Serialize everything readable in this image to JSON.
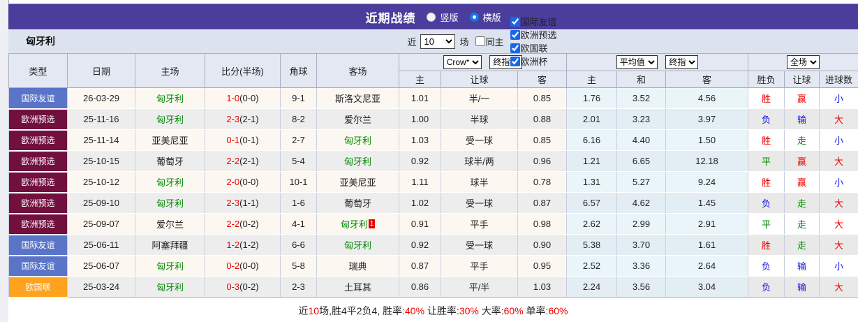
{
  "colors": {
    "accent_purple": "#4a3d9c",
    "type_国际友谊": "#5a74c8",
    "type_欧洲预选": "#71103f",
    "type_欧国联": "#ffa21d",
    "team_green": "#008800",
    "red": "#f00000",
    "blue": "#1414e0",
    "green": "#008800"
  },
  "titlebar": {
    "title": "近期战绩",
    "radio_vertical_label": "竖版",
    "radio_horizontal_label": "横版",
    "selected_layout": "横版"
  },
  "filter": {
    "team": "匈牙利",
    "near_label": "近",
    "match_count": "10",
    "games_label": "场",
    "same_home_label": "同主",
    "same_home_checked": false,
    "league_filters": [
      {
        "label": "国际友谊",
        "checked": true
      },
      {
        "label": "欧洲预选",
        "checked": true
      },
      {
        "label": "欧国联",
        "checked": true
      },
      {
        "label": "欧洲杯",
        "checked": true
      }
    ]
  },
  "table": {
    "main_headers": [
      "类型",
      "日期",
      "主场",
      "比分(半场)",
      "角球",
      "客场"
    ],
    "selects": {
      "company": "Crow*",
      "company_stage": "终指",
      "average": "平均值",
      "average_stage": "终指",
      "scope": "全场"
    },
    "sub_headers": [
      "主",
      "让球",
      "客",
      "主",
      "和",
      "客",
      "胜负",
      "让球",
      "进球数"
    ],
    "rows": [
      {
        "type": "国际友谊",
        "date": "26-03-29",
        "home": "匈牙利",
        "home_focus": true,
        "score": "1-0",
        "half": "(0-0)",
        "corners": "9-1",
        "away": "斯洛文尼亚",
        "away_focus": false,
        "away_sup": "",
        "odds": [
          "1.01",
          "半/一",
          "0.85"
        ],
        "avg": [
          "1.76",
          "3.52",
          "4.56"
        ],
        "outcome": [
          "胜",
          "red"
        ],
        "handicap": [
          "赢",
          "red"
        ],
        "goals": [
          "小",
          "blue"
        ]
      },
      {
        "type": "欧洲预选",
        "date": "25-11-16",
        "home": "匈牙利",
        "home_focus": true,
        "score": "2-3",
        "half": "(2-1)",
        "corners": "8-2",
        "away": "爱尔兰",
        "away_focus": false,
        "away_sup": "",
        "odds": [
          "1.00",
          "半球",
          "0.88"
        ],
        "avg": [
          "2.01",
          "3.23",
          "3.97"
        ],
        "outcome": [
          "负",
          "blue"
        ],
        "handicap": [
          "输",
          "blue"
        ],
        "goals": [
          "大",
          "red"
        ]
      },
      {
        "type": "欧洲预选",
        "date": "25-11-14",
        "home": "亚美尼亚",
        "home_focus": false,
        "score": "0-1",
        "half": "(0-1)",
        "corners": "2-7",
        "away": "匈牙利",
        "away_focus": true,
        "away_sup": "",
        "odds": [
          "1.03",
          "受一球",
          "0.85"
        ],
        "avg": [
          "6.16",
          "4.40",
          "1.50"
        ],
        "outcome": [
          "胜",
          "red"
        ],
        "handicap": [
          "走",
          "green"
        ],
        "goals": [
          "小",
          "blue"
        ]
      },
      {
        "type": "欧洲预选",
        "date": "25-10-15",
        "home": "葡萄牙",
        "home_focus": false,
        "score": "2-2",
        "half": "(2-1)",
        "corners": "5-4",
        "away": "匈牙利",
        "away_focus": true,
        "away_sup": "",
        "odds": [
          "0.92",
          "球半/两",
          "0.96"
        ],
        "avg": [
          "1.21",
          "6.65",
          "12.18"
        ],
        "outcome": [
          "平",
          "green"
        ],
        "handicap": [
          "赢",
          "red"
        ],
        "goals": [
          "大",
          "red"
        ]
      },
      {
        "type": "欧洲预选",
        "date": "25-10-12",
        "home": "匈牙利",
        "home_focus": true,
        "score": "2-0",
        "half": "(0-0)",
        "corners": "10-1",
        "away": "亚美尼亚",
        "away_focus": false,
        "away_sup": "",
        "odds": [
          "1.11",
          "球半",
          "0.78"
        ],
        "avg": [
          "1.31",
          "5.27",
          "9.24"
        ],
        "outcome": [
          "胜",
          "red"
        ],
        "handicap": [
          "赢",
          "red"
        ],
        "goals": [
          "小",
          "blue"
        ]
      },
      {
        "type": "欧洲预选",
        "date": "25-09-10",
        "home": "匈牙利",
        "home_focus": true,
        "score": "2-3",
        "half": "(1-1)",
        "corners": "1-6",
        "away": "葡萄牙",
        "away_focus": false,
        "away_sup": "",
        "odds": [
          "1.02",
          "受一球",
          "0.87"
        ],
        "avg": [
          "6.57",
          "4.62",
          "1.45"
        ],
        "outcome": [
          "负",
          "blue"
        ],
        "handicap": [
          "走",
          "green"
        ],
        "goals": [
          "大",
          "red"
        ]
      },
      {
        "type": "欧洲预选",
        "date": "25-09-07",
        "home": "爱尔兰",
        "home_focus": false,
        "score": "2-2",
        "half": "(0-2)",
        "corners": "4-1",
        "away": "匈牙利",
        "away_focus": true,
        "away_sup": "1",
        "odds": [
          "0.91",
          "平手",
          "0.98"
        ],
        "avg": [
          "2.62",
          "2.99",
          "2.91"
        ],
        "outcome": [
          "平",
          "green"
        ],
        "handicap": [
          "走",
          "green"
        ],
        "goals": [
          "大",
          "red"
        ]
      },
      {
        "type": "国际友谊",
        "date": "25-06-11",
        "home": "阿塞拜疆",
        "home_focus": false,
        "score": "1-2",
        "half": "(1-2)",
        "corners": "6-6",
        "away": "匈牙利",
        "away_focus": true,
        "away_sup": "",
        "odds": [
          "0.92",
          "受一球",
          "0.90"
        ],
        "avg": [
          "5.38",
          "3.70",
          "1.61"
        ],
        "outcome": [
          "胜",
          "red"
        ],
        "handicap": [
          "走",
          "green"
        ],
        "goals": [
          "大",
          "red"
        ]
      },
      {
        "type": "国际友谊",
        "date": "25-06-07",
        "home": "匈牙利",
        "home_focus": true,
        "score": "0-2",
        "half": "(0-0)",
        "corners": "5-8",
        "away": "瑞典",
        "away_focus": false,
        "away_sup": "",
        "odds": [
          "0.87",
          "平手",
          "0.95"
        ],
        "avg": [
          "2.52",
          "3.36",
          "2.64"
        ],
        "outcome": [
          "负",
          "blue"
        ],
        "handicap": [
          "输",
          "blue"
        ],
        "goals": [
          "小",
          "blue"
        ]
      },
      {
        "type": "欧国联",
        "date": "25-03-24",
        "home": "匈牙利",
        "home_focus": true,
        "score": "0-3",
        "half": "(0-2)",
        "corners": "2-3",
        "away": "土耳其",
        "away_focus": false,
        "away_sup": "",
        "odds": [
          "0.86",
          "平/半",
          "1.03"
        ],
        "avg": [
          "2.24",
          "3.56",
          "3.04"
        ],
        "outcome": [
          "负",
          "blue"
        ],
        "handicap": [
          "输",
          "blue"
        ],
        "goals": [
          "大",
          "red"
        ]
      }
    ]
  },
  "footer": {
    "segments": [
      {
        "text": "近",
        "red": false
      },
      {
        "text": "10",
        "red": true
      },
      {
        "text": "场,胜4平2负4, 胜率:",
        "red": false
      },
      {
        "text": "40%",
        "red": true
      },
      {
        "text": " 让胜率:",
        "red": false
      },
      {
        "text": "30%",
        "red": true
      },
      {
        "text": " 大率:",
        "red": false
      },
      {
        "text": "60%",
        "red": true
      },
      {
        "text": " 单率:",
        "red": false
      },
      {
        "text": "60%",
        "red": true
      }
    ]
  }
}
